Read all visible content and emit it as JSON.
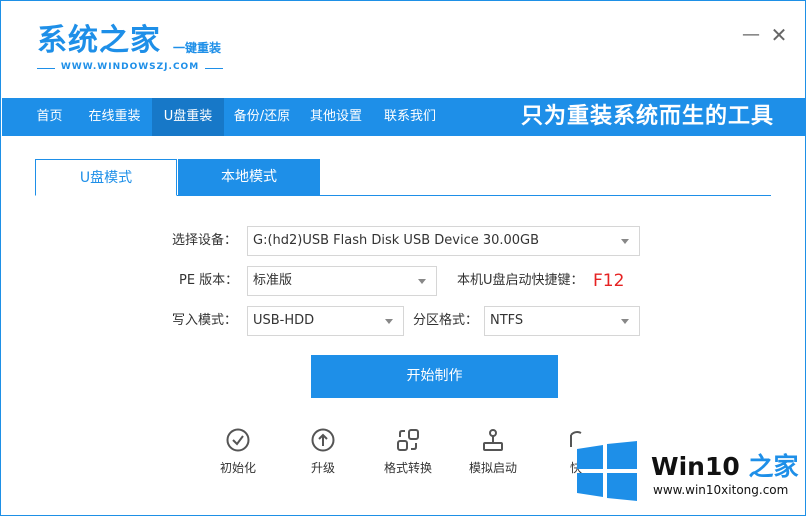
{
  "app": {
    "logo_title": "系统之家",
    "logo_subtitle": "一键重装",
    "logo_url": "WWW.WINDOWSZJ.COM"
  },
  "window_controls": {
    "minimize": "—",
    "close": "✕"
  },
  "nav": {
    "items": [
      {
        "label": "首页"
      },
      {
        "label": "在线重装"
      },
      {
        "label": "U盘重装"
      },
      {
        "label": "备份/还原"
      },
      {
        "label": "其他设置"
      },
      {
        "label": "联系我们"
      }
    ],
    "active_index": 2,
    "slogan": "只为重装系统而生的工具"
  },
  "tabs": [
    {
      "label": "U盘模式",
      "active": true
    },
    {
      "label": "本地模式",
      "active": false
    }
  ],
  "form": {
    "device_label": "选择设备：",
    "device_value": "G:(hd2)USB Flash Disk USB Device 30.00GB",
    "pe_label": "PE 版本：",
    "pe_value": "标准版",
    "hotkey_label": "本机U盘启动快捷键：",
    "hotkey_value": "F12",
    "write_mode_label": "写入模式：",
    "write_mode_value": "USB-HDD",
    "partition_label": "分区格式：",
    "partition_value": "NTFS"
  },
  "start_button": "开始制作",
  "tools": [
    {
      "label": "初始化",
      "icon": "check-circle-icon"
    },
    {
      "label": "升级",
      "icon": "upgrade-arrow-icon"
    },
    {
      "label": "格式转换",
      "icon": "convert-icon"
    },
    {
      "label": "模拟启动",
      "icon": "joystick-icon"
    },
    {
      "label": "快",
      "icon": "power-icon"
    }
  ],
  "watermark": {
    "brand_main": "Win10",
    "brand_accent": " 之家",
    "url": "www.win10xitong.com"
  },
  "colors": {
    "accent": "#1e8fe8",
    "nav_active": "#1778c8",
    "hotkey": "#e62222"
  }
}
